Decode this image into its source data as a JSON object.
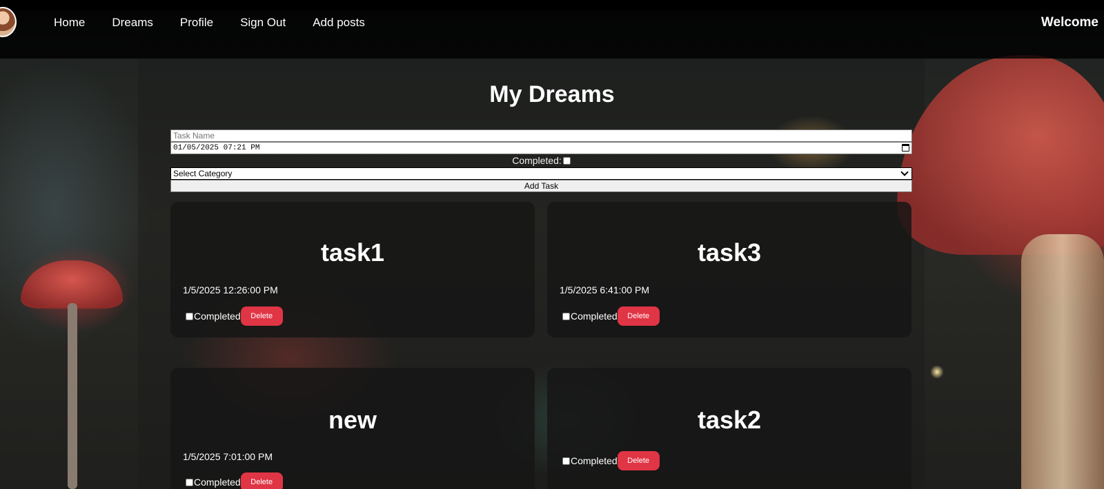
{
  "nav": {
    "links": [
      "Home",
      "Dreams",
      "Profile",
      "Sign Out",
      "Add posts"
    ],
    "welcome": "Welcome"
  },
  "page": {
    "title": "My Dreams"
  },
  "form": {
    "task_name_placeholder": "Task Name",
    "datetime_value": "01/05/2025 07:21 PM",
    "completed_label": "Completed:",
    "category_selected": "Select Category",
    "add_button_label": "Add Task"
  },
  "tasks": [
    {
      "title": "task1",
      "date": "1/5/2025 12:26:00 PM",
      "completed_label": "Completed",
      "delete_label": "Delete"
    },
    {
      "title": "task3",
      "date": "1/5/2025 6:41:00 PM",
      "completed_label": "Completed",
      "delete_label": "Delete"
    },
    {
      "title": "new",
      "date": "1/5/2025 7:01:00 PM",
      "completed_label": "Completed",
      "delete_label": "Delete"
    },
    {
      "title": "task2",
      "date": "",
      "completed_label": "Completed",
      "delete_label": "Delete"
    }
  ],
  "colors": {
    "delete_button": "#e03545",
    "card_background": "#161616",
    "navbar": "#000000"
  }
}
